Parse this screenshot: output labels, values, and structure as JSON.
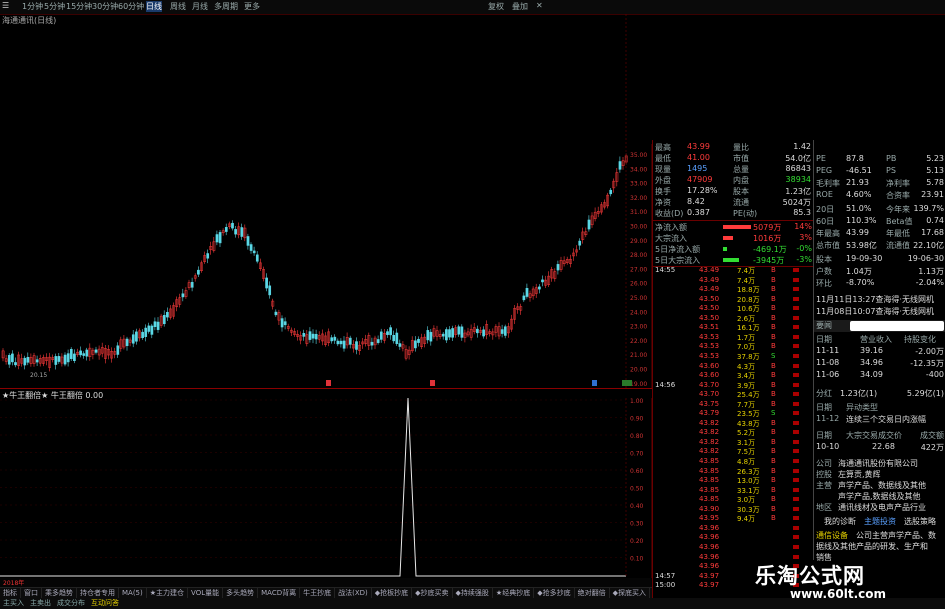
{
  "topbar": {
    "periods": [
      "1分钟",
      "5分钟",
      "15分钟",
      "30分钟",
      "60分钟",
      "日线",
      "周线",
      "月线",
      "多周期",
      "更多"
    ],
    "right": [
      "复权",
      "叠加"
    ]
  },
  "stock_title": "海通通讯(日线)",
  "indicator_title": "★牛王翻倍★ 牛王翻倍 0.00",
  "price_axis": [
    "35.00",
    "34.00",
    "33.00",
    "32.00",
    "31.00",
    "30.00",
    "29.00",
    "28.00",
    "27.00",
    "26.00",
    "25.00",
    "24.00",
    "23.00",
    "22.00",
    "21.00",
    "20.00",
    "19.00"
  ],
  "ind_axis": [
    "1.00",
    "0.90",
    "0.80",
    "0.70",
    "0.60",
    "0.50",
    "0.40",
    "0.30",
    "0.20",
    "0.10"
  ],
  "low_label": "20.15",
  "ind_value_label": "1",
  "bottom_tabs": [
    "指标",
    "窗口",
    "乘多趋势",
    "持仓者专用",
    "MA(5)",
    "★主力建仓",
    "VOL量能",
    "多头趋势",
    "MACD背离",
    "牛王抄底",
    "战法(XD)",
    "◆抢板抄底",
    "◆抄底买卖",
    "◆持续强股",
    "★经典抄底",
    "◆抢多抄底",
    "绝对翻倍",
    "◆探底买入"
  ],
  "status_bar": [
    "主买入",
    "主卖出",
    "成交分布",
    "互动问答"
  ],
  "bottom_time_label": "2018年",
  "panel_quote": [
    {
      "l1": "最高",
      "v1": "43.99",
      "l2": "量比",
      "v2": "1.42"
    },
    {
      "l1": "最低",
      "v1": "41.00",
      "l2": "市值",
      "v2": "54.0亿"
    },
    {
      "l1": "现量",
      "v1": "1495",
      "l2": "总量",
      "v2": "86843"
    },
    {
      "l1": "外盘",
      "v1": "47909",
      "l2": "内盘",
      "v2": "38934"
    },
    {
      "l1": "换手",
      "v1": "17.28%",
      "l2": "股本",
      "v2": "1.23亿"
    },
    {
      "l1": "净资",
      "v1": "8.42",
      "l2": "流通",
      "v2": "5024万"
    },
    {
      "l1": "收益(D)",
      "v1": "0.387",
      "l2": "PE(动)",
      "v2": "85.3"
    }
  ],
  "panel_flow": [
    {
      "label": "净流入额",
      "value": "5079万",
      "pct": "14%"
    },
    {
      "label": "大宗流入",
      "value": "1016万",
      "pct": "3%"
    },
    {
      "label": "5日净流入额",
      "value": "-469.1万",
      "pct": "-0%"
    },
    {
      "label": "5日大宗流入",
      "value": "-3945万",
      "pct": "-3%"
    }
  ],
  "ticks": [
    {
      "t": "14:55",
      "p": "43.49",
      "v": "7.4万",
      "f": "B"
    },
    {
      "t": "",
      "p": "43.49",
      "v": "7.4万",
      "f": "B"
    },
    {
      "t": "",
      "p": "43.49",
      "v": "18.8万",
      "f": "B"
    },
    {
      "t": "",
      "p": "43.50",
      "v": "20.8万",
      "f": "B"
    },
    {
      "t": "",
      "p": "43.50",
      "v": "10.6万",
      "f": "B"
    },
    {
      "t": "",
      "p": "43.50",
      "v": "2.6万",
      "f": "B"
    },
    {
      "t": "",
      "p": "43.51",
      "v": "16.1万",
      "f": "B"
    },
    {
      "t": "",
      "p": "43.53",
      "v": "1.7万",
      "f": "B"
    },
    {
      "t": "",
      "p": "43.53",
      "v": "7.0万",
      "f": "B"
    },
    {
      "t": "",
      "p": "43.53",
      "v": "37.8万",
      "f": "S"
    },
    {
      "t": "",
      "p": "43.60",
      "v": "4.3万",
      "f": "B"
    },
    {
      "t": "",
      "p": "43.60",
      "v": "3.4万",
      "f": "B"
    },
    {
      "t": "14:56",
      "p": "43.70",
      "v": "3.9万",
      "f": "B"
    },
    {
      "t": "",
      "p": "43.70",
      "v": "25.4万",
      "f": "B"
    },
    {
      "t": "",
      "p": "43.75",
      "v": "7.7万",
      "f": "B"
    },
    {
      "t": "",
      "p": "43.79",
      "v": "23.5万",
      "f": "S"
    },
    {
      "t": "",
      "p": "43.82",
      "v": "43.8万",
      "f": "B"
    },
    {
      "t": "",
      "p": "43.82",
      "v": "5.2万",
      "f": "B"
    },
    {
      "t": "",
      "p": "43.82",
      "v": "3.1万",
      "f": "B"
    },
    {
      "t": "",
      "p": "43.82",
      "v": "7.5万",
      "f": "B"
    },
    {
      "t": "",
      "p": "43.85",
      "v": "4.8万",
      "f": "B"
    },
    {
      "t": "",
      "p": "43.85",
      "v": "26.3万",
      "f": "B"
    },
    {
      "t": "",
      "p": "43.85",
      "v": "13.0万",
      "f": "B"
    },
    {
      "t": "",
      "p": "43.85",
      "v": "33.1万",
      "f": "B"
    },
    {
      "t": "",
      "p": "43.85",
      "v": "3.0万",
      "f": "B"
    },
    {
      "t": "",
      "p": "43.90",
      "v": "30.3万",
      "f": "B"
    },
    {
      "t": "",
      "p": "43.95",
      "v": "9.4万",
      "f": "B"
    },
    {
      "t": "",
      "p": "43.96",
      "v": "",
      "f": ""
    },
    {
      "t": "",
      "p": "43.96",
      "v": "",
      "f": ""
    },
    {
      "t": "",
      "p": "43.96",
      "v": "",
      "f": ""
    },
    {
      "t": "",
      "p": "43.96",
      "v": "",
      "f": ""
    },
    {
      "t": "",
      "p": "43.96",
      "v": "",
      "f": ""
    },
    {
      "t": "14:57",
      "p": "43.97",
      "v": "",
      "f": ""
    },
    {
      "t": "15:00",
      "p": "43.97",
      "v": "",
      "f": ""
    }
  ],
  "f10": {
    "rows1": [
      {
        "a": "PE",
        "b": "87.8",
        "c": "PB",
        "d": "5.23"
      },
      {
        "a": "PEG",
        "b": "-46.51",
        "c": "PS",
        "d": "5.13"
      },
      {
        "a": "毛利率",
        "b": "21.93",
        "c": "净利率",
        "d": "5.78"
      },
      {
        "a": "ROE",
        "b": "4.60%",
        "c": "合资率",
        "d": "23.91"
      },
      {
        "a": "20日",
        "b": "51.0%",
        "c": "今年来",
        "d": "139.7%"
      },
      {
        "a": "60日",
        "b": "110.3%",
        "c": "Beta值",
        "d": "0.74"
      },
      {
        "a": "年最高",
        "b": "43.99",
        "c": "年最低",
        "d": "17.68"
      },
      {
        "a": "总市值",
        "b": "53.98亿",
        "c": "流通值",
        "d": "22.10亿"
      },
      {
        "a": "股本",
        "b": "19-09-30",
        "c": "",
        "d": "19-06-30"
      },
      {
        "a": "户数",
        "b": "1.04万",
        "c": "",
        "d": "1.13万"
      },
      {
        "a": "环比",
        "b": "-8.70%",
        "c": "",
        "d": "-2.04%"
      }
    ],
    "news": [
      "11月11日13:27查海得·无线网机",
      "11月08日10:07查海得·无线网机"
    ],
    "heading_a": "要闻",
    "cols2": [
      "日期",
      "营业收入",
      "持股变化"
    ],
    "rows2": [
      {
        "a": "11-11",
        "b": "39.16",
        "c": "-2.00万"
      },
      {
        "a": "11-08",
        "b": "34.96",
        "c": "-12.35万"
      },
      {
        "a": "11-06",
        "b": "34.09",
        "c": "-400"
      }
    ],
    "fen_hong": {
      "label": "分红",
      "v1": "1.23亿(1)",
      "v2": "5.29亿(1)"
    },
    "events": [
      {
        "a": "日期",
        "b": "异动类型"
      },
      {
        "a": "11-12",
        "b": "连续三个交易日内涨幅"
      }
    ],
    "dzjy": {
      "a": "日期",
      "b": "大宗交易成交价",
      "c": "成交额"
    },
    "dzjy_row": {
      "a": "10-10",
      "b": "22.68",
      "c": "422万"
    },
    "company": [
      {
        "a": "公司",
        "b": "海通通讯股份有限公司"
      },
      {
        "a": "控股",
        "b": "左算贡,黄辉"
      },
      {
        "a": "主营",
        "b": "声学产品、数据线及其他"
      },
      {
        "a": "",
        "b": "声学产品,数据线及其他"
      },
      {
        "a": "地区",
        "b": "通讯线材及电声产品行业"
      }
    ],
    "links": [
      "我的诊断",
      "主题投资",
      "选股策略"
    ],
    "intro_title": "通信设备",
    "intro": [
      "公司主营声学产品、数",
      "据线及其他产品的研发、生产和",
      "销售"
    ]
  },
  "watermark": {
    "line1": "乐淘公式网",
    "line2": "www.60lt.com"
  },
  "colors": {
    "up": "#ff3b3b",
    "down": "#5ad8e6",
    "grid": "#6a0000",
    "bg": "#000000"
  }
}
